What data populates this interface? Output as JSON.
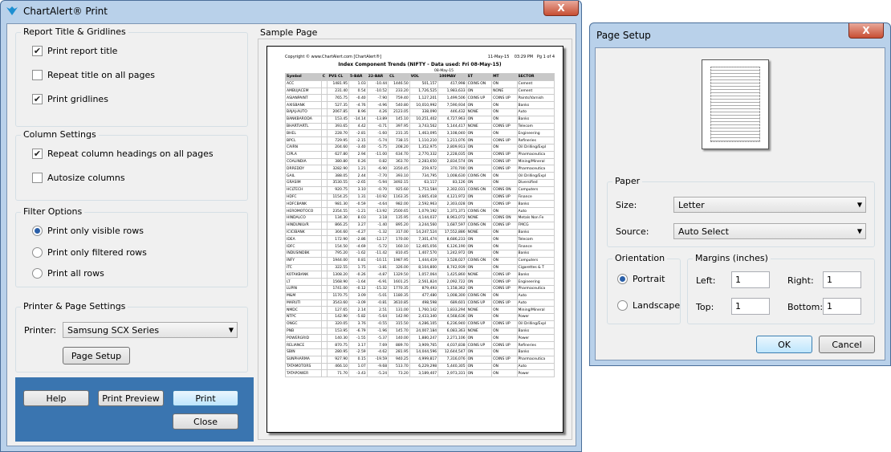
{
  "print_window": {
    "title": "ChartAlert® Print",
    "close_glyph": "X",
    "report_title_group": {
      "title": "Report Title & Gridlines",
      "options": [
        {
          "label": "Print report title",
          "checked": true
        },
        {
          "label": "Repeat title on all pages",
          "checked": false
        },
        {
          "label": "Print gridlines",
          "checked": true
        }
      ]
    },
    "column_group": {
      "title": "Column Settings",
      "options": [
        {
          "label": "Repeat column headings on all pages",
          "checked": true
        },
        {
          "label": "Autosize columns",
          "checked": false
        }
      ]
    },
    "filter_group": {
      "title": "Filter Options",
      "options": [
        {
          "label": "Print only visible rows",
          "selected": true
        },
        {
          "label": "Print only filtered rows",
          "selected": false
        },
        {
          "label": "Print all rows",
          "selected": false
        }
      ]
    },
    "printer_group": {
      "title": "Printer & Page Settings",
      "printer_label": "Printer:",
      "printer_value": "Samsung SCX Series",
      "page_setup_label": "Page Setup"
    },
    "buttons": {
      "help": "Help",
      "preview": "Print Preview",
      "print": "Print",
      "close": "Close"
    },
    "sample_page_title": "Sample Page",
    "sample": {
      "copyright": "Copyright © www.ChartAlert.com [ChartAlert®]",
      "date": "11-May-15",
      "time": "03:29 PM",
      "page": "Pg 1 of 4",
      "report_title": "Index Component Trends (NIFTY - Data used: Fri 08-May-15)",
      "date_header": "08-May-15",
      "columns": [
        "Symbol",
        "C",
        "PVS CL",
        "5-BAR",
        "22-BAR",
        "CL",
        "VOL",
        "100MAV",
        "ST",
        "MT",
        "SECTOR"
      ],
      "rows": [
        [
          "ACC",
          "",
          "1481.95",
          "1.03",
          "-10.44",
          "1446.50",
          "501,157",
          "417,998",
          "COINS ON",
          "ON",
          "Cement"
        ],
        [
          "AMBUJACEM",
          "",
          "231.40",
          "0.54",
          "-10.52",
          "233.20",
          "1,726,525",
          "1,983,633",
          "ON",
          "NONE",
          "Cement"
        ],
        [
          "ASIANPAINT",
          "",
          "765.75",
          "-0.40",
          "-7.90",
          "759.40",
          "1,127,201",
          "1,499,506",
          "COINS UP",
          "COINS UP",
          "Paints/Varnish"
        ],
        [
          "AXISBANK",
          "",
          "527.35",
          "-4.76",
          "-4.96",
          "540.80",
          "10,010,992",
          "7,590,934",
          "ON",
          "ON",
          "Banks"
        ],
        [
          "BAJAJ-AUTO",
          "",
          "2067.85",
          "8.96",
          "4.26",
          "2123.05",
          "338,090",
          "446,432",
          "NONE",
          "ON",
          "Auto"
        ],
        [
          "BANKBARODA",
          "",
          "153.45",
          "-14.14",
          "-13.89",
          "145.10",
          "10,251,402",
          "4,727,963",
          "ON",
          "ON",
          "Banks"
        ],
        [
          "BHARTIARTL",
          "",
          "393.65",
          "4.42",
          "-0.71",
          "397.95",
          "3,743,562",
          "5,144,417",
          "NONE",
          "COINS UP",
          "Telecom"
        ],
        [
          "BHEL",
          "",
          "228.70",
          "-2.81",
          "-1.60",
          "231.35",
          "1,463,095",
          "3,108,040",
          "ON",
          "ON",
          "Engineering"
        ],
        [
          "BPCL",
          "",
          "729.95",
          "-2.15",
          "-5.74",
          "738.15",
          "1,110,210",
          "1,211,076",
          "ON",
          "COINS UP",
          "Refineries"
        ],
        [
          "CAIRN",
          "",
          "204.60",
          "-3.40",
          "-5.75",
          "208.20",
          "1,352,975",
          "2,809,913",
          "ON",
          "ON",
          "Oil Drilling/Expl"
        ],
        [
          "CIPLA",
          "",
          "627.80",
          "2.94",
          "-11.00",
          "634.70",
          "2,770,332",
          "2,228,035",
          "ON",
          "COINS UP",
          "Pharmaceutica"
        ],
        [
          "COALINDIA",
          "",
          "380.80",
          "0.26",
          "0.82",
          "363.70",
          "2,283,650",
          "2,834,574",
          "ON",
          "COINS UP",
          "Mining/Mineral"
        ],
        [
          "DRREDDY",
          "",
          "3282.90",
          "1.21",
          "-6.90",
          "3350.45",
          "259,972",
          "370,700",
          "ON",
          "COINS UP",
          "Pharmaceutica"
        ],
        [
          "GAIL",
          "",
          "388.05",
          "2.44",
          "-7.70",
          "393.10",
          "734,795",
          "1,008,630",
          "COINS ON",
          "ON",
          "Oil Drilling/Expl"
        ],
        [
          "GRASIM",
          "",
          "3530.55",
          "-2.65",
          "-5.94",
          "3492.15",
          "63,117",
          "83,126",
          "ON",
          "ON",
          "Diversified"
        ],
        [
          "HCLTECH",
          "",
          "920.75",
          "3.10",
          "-0.70",
          "925.60",
          "1,753,584",
          "2,302,031",
          "COINS ON",
          "COINS ON",
          "Computers"
        ],
        [
          "HDFC",
          "",
          "1154.25",
          "1.31",
          "-10.92",
          "1163.35",
          "3,665,418",
          "4,121,972",
          "ON",
          "COINS UP",
          "Finance"
        ],
        [
          "HDFCBANK",
          "",
          "981.30",
          "-0.59",
          "-4.64",
          "982.00",
          "2,592,963",
          "2,303,028",
          "ON",
          "COINS UP",
          "Banks"
        ],
        [
          "HEROMOTOCO",
          "",
          "2354.55",
          "-1.21",
          "-13.92",
          "2500.65",
          "1,079,192",
          "1,371,371",
          "COINS ON",
          "ON",
          "Auto"
        ],
        [
          "HINDALCO",
          "",
          "134.30",
          "8.03",
          "3.18",
          "135.95",
          "4,144,037",
          "8,963,072",
          "NONE",
          "COINS ON",
          "Metals Non Fe"
        ],
        [
          "HINDUNILVR",
          "",
          "866.25",
          "3.27",
          "-1.40",
          "895.20",
          "3,244,560",
          "1,687,597",
          "COINS ON",
          "COINS UP",
          "FMCG"
        ],
        [
          "ICICIBANK",
          "",
          "304.60",
          "-4.27",
          "-1.32",
          "317.00",
          "14,247,524",
          "17,552,886",
          "NONE",
          "ON",
          "Banks"
        ],
        [
          "IDEA",
          "",
          "172.90",
          "-2.86",
          "-12.17",
          "170.00",
          "7,301,474",
          "8,686,233",
          "ON",
          "ON",
          "Telecom"
        ],
        [
          "IDFC",
          "",
          "154.50",
          "-4.69",
          "-5.72",
          "160.10",
          "12,465,056",
          "6,126,190",
          "ON",
          "ON",
          "Finance"
        ],
        [
          "INDUSINDBK",
          "",
          "795.20",
          "-1.62",
          "-11.42",
          "810.45",
          "1,407,570",
          "1,242,972",
          "ON",
          "ON",
          "Banks"
        ],
        [
          "INFY",
          "",
          "1944.00",
          "0.81",
          "-10.11",
          "1987.95",
          "1,444,419",
          "3,528,027",
          "COINS ON",
          "ON",
          "Computers"
        ],
        [
          "ITC",
          "",
          "322.55",
          "1.75",
          "-3.81",
          "326.00",
          "8,104,800",
          "8,742,939",
          "ON",
          "ON",
          "Cigarettes & T"
        ],
        [
          "KOTAKBANK",
          "",
          "1308.20",
          "-0.26",
          "-4.87",
          "1329.50",
          "1,057,064",
          "1,425,860",
          "NONE",
          "COINS UP",
          "Banks"
        ],
        [
          "LT",
          "",
          "1568.90",
          "-1.64",
          "-6.91",
          "1601.25",
          "2,561,824",
          "2,092,722",
          "ON",
          "COINS UP",
          "Engineering"
        ],
        [
          "LUPIN",
          "",
          "1741.00",
          "-0.12",
          "-15.32",
          "1770.35",
          "879,493",
          "1,158,362",
          "ON",
          "COINS UP",
          "Pharmaceutica"
        ],
        [
          "M&M",
          "",
          "1170.75",
          "3.09",
          "-5.01",
          "1180.35",
          "477,480",
          "1,008,300",
          "COINS ON",
          "ON",
          "Auto"
        ],
        [
          "MARUTI",
          "",
          "3543.60",
          "-3.09",
          "-0.81",
          "3610.85",
          "498,598",
          "689,601",
          "COINS UP",
          "COINS UP",
          "Auto"
        ],
        [
          "NMDC",
          "",
          "127.65",
          "2.14",
          "2.51",
          "131.00",
          "1,760,142",
          "1,833,294",
          "NONE",
          "ON",
          "Mining/Mineral"
        ],
        [
          "NTPC",
          "",
          "142.90",
          "-5.82",
          "-5.64",
          "142.90",
          "2,433,340",
          "4,568,636",
          "ON",
          "ON",
          "Power"
        ],
        [
          "ONGC",
          "",
          "320.05",
          "3.76",
          "-0.55",
          "315.50",
          "4,286,105",
          "6,236,940",
          "COINS UP",
          "COINS UP",
          "Oil Drilling/Expl"
        ],
        [
          "PNB",
          "",
          "153.95",
          "-6.79",
          "-1.96",
          "145.70",
          "24,007,184",
          "6,083,363",
          "NONE",
          "ON",
          "Banks"
        ],
        [
          "POWERGRID",
          "",
          "140.30",
          "-1.55",
          "-5.37",
          "140.00",
          "1,880,247",
          "2,271,106",
          "ON",
          "ON",
          "Power"
        ],
        [
          "RELIANCE",
          "",
          "870.75",
          "3.17",
          "7.69",
          "889.70",
          "3,909,765",
          "4,037,838",
          "COINS UP",
          "COINS UP",
          "Refineries"
        ],
        [
          "SBIN",
          "",
          "280.95",
          "-2.59",
          "-4.62",
          "281.95",
          "14,044,596",
          "12,644,547",
          "ON",
          "ON",
          "Banks"
        ],
        [
          "SUNPHARMA",
          "",
          "927.90",
          "0.15",
          "-19.59",
          "940.25",
          "4,999,817",
          "7,316,076",
          "ON",
          "COINS UP",
          "Pharmaceutica"
        ],
        [
          "TATAMOTORS",
          "",
          "466.10",
          "1.07",
          "-9.68",
          "513.70",
          "6,229,298",
          "5,440,305",
          "ON",
          "ON",
          "Auto"
        ],
        [
          "TATAPOWER",
          "",
          "71.70",
          "-3.43",
          "-5.24",
          "73.20",
          "3,189,407",
          "2,973,331",
          "ON",
          "ON",
          "Power"
        ]
      ]
    }
  },
  "page_setup": {
    "title": "Page Setup",
    "close_glyph": "X",
    "paper_title": "Paper",
    "size_label": "Size:",
    "size_value": "Letter",
    "source_label": "Source:",
    "source_value": "Auto Select",
    "orientation_title": "Orientation",
    "portrait": "Portrait",
    "landscape": "Landscape",
    "margins_title": "Margins (inches)",
    "left_label": "Left:",
    "left_value": "1",
    "right_label": "Right:",
    "right_value": "1",
    "top_label": "Top:",
    "top_value": "1",
    "bottom_label": "Bottom:",
    "bottom_value": "1",
    "ok": "OK",
    "cancel": "Cancel"
  }
}
